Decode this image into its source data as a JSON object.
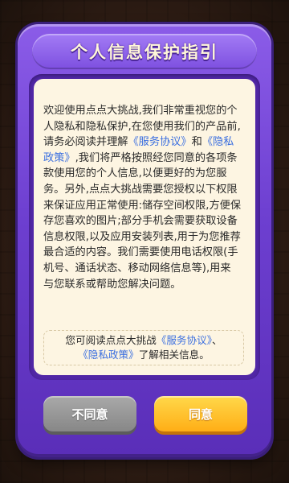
{
  "dialog": {
    "title": "个人信息保护指引",
    "body": {
      "p1": "欢迎使用点点大挑战,我们非常重视您的个人隐私和隐私保护,在您使用我们的产品前,请务必阅读并理解",
      "link_service": "《服务协议》",
      "and": "和",
      "link_privacy": "《隐私政策》",
      "p2": ",我们将严格按照经您同意的各项条款使用您的个人信息,以便更好的为您服务。另外,点点大挑战需要您授权以下权限来保证应用正常使用:储存空间权限,方便保存您喜欢的图片;部分手机会需要获取设备信息权限,以及应用安装列表,用于为您推荐最合适的内容。我们需要使用电话权限(手机号、通话状态、移动网络信息等),用来与您联系或帮助您解决问题。"
    },
    "notice": {
      "prefix": "您可阅读点点大挑战",
      "link_service": "《服务协议》",
      "separator": "、",
      "link_privacy": "《隐私政策》",
      "suffix": "了解相关信息。"
    },
    "buttons": {
      "disagree_label": "不同意",
      "agree_label": "同意"
    }
  },
  "colors": {
    "frame_purple": "#6d3fd0",
    "title_text": "#fff7d8",
    "paper": "#fdf5e2",
    "link": "#3b6fe0",
    "agree_button": "#ffc22a",
    "disagree_button": "#999999"
  }
}
